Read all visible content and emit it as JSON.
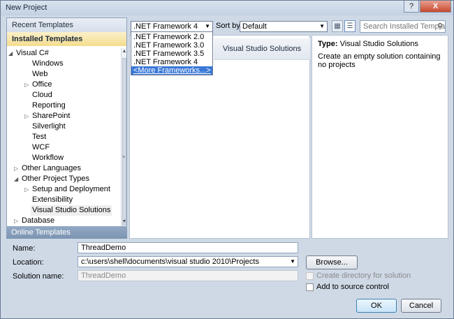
{
  "window": {
    "title": "New Project",
    "help_label": "?",
    "close_label": "X"
  },
  "left": {
    "recent_templates": "Recent Templates",
    "installed_templates": "Installed Templates",
    "online_templates": "Online Templates",
    "tree": [
      {
        "label": "Visual C#",
        "arrow": "◢"
      },
      {
        "label": "Windows"
      },
      {
        "label": "Web"
      },
      {
        "label": "Office",
        "arrow": "▷"
      },
      {
        "label": "Cloud"
      },
      {
        "label": "Reporting"
      },
      {
        "label": "SharePoint",
        "arrow": "▷"
      },
      {
        "label": "Silverlight"
      },
      {
        "label": "Test"
      },
      {
        "label": "WCF"
      },
      {
        "label": "Workflow"
      },
      {
        "label": "Other Languages",
        "arrow": "▷"
      },
      {
        "label": "Other Project Types",
        "arrow": "◢"
      },
      {
        "label": "Setup and Deployment",
        "arrow": "▷"
      },
      {
        "label": "Extensibility"
      },
      {
        "label": "Visual Studio Solutions",
        "selected": true
      },
      {
        "label": "Database",
        "arrow": "▷"
      }
    ]
  },
  "toolbar": {
    "framework_selected": ".NET Framework 4",
    "sort_label": "Sort by:",
    "sort_value": "Default",
    "search_placeholder": "Search Installed Templat"
  },
  "framework_options": [
    ".NET Framework 2.0",
    ".NET Framework 3.0",
    ".NET Framework 3.5",
    ".NET Framework 4",
    "<More Frameworks...>"
  ],
  "templates": [
    {
      "name": "Visual Studio Solutions"
    }
  ],
  "details": {
    "type_label": "Type:",
    "type_value": "Visual Studio Solutions",
    "description": "Create an empty solution containing no projects"
  },
  "form": {
    "name_label": "Name:",
    "name_value": "ThreadDemo",
    "location_label": "Location:",
    "location_value": "c:\\users\\shell\\documents\\visual studio 2010\\Projects",
    "solution_label": "Solution name:",
    "solution_value": "ThreadDemo",
    "browse_label": "Browse...",
    "create_dir_label": "Create directory for solution",
    "source_control_label": "Add to source control",
    "ok_label": "OK",
    "cancel_label": "Cancel"
  }
}
